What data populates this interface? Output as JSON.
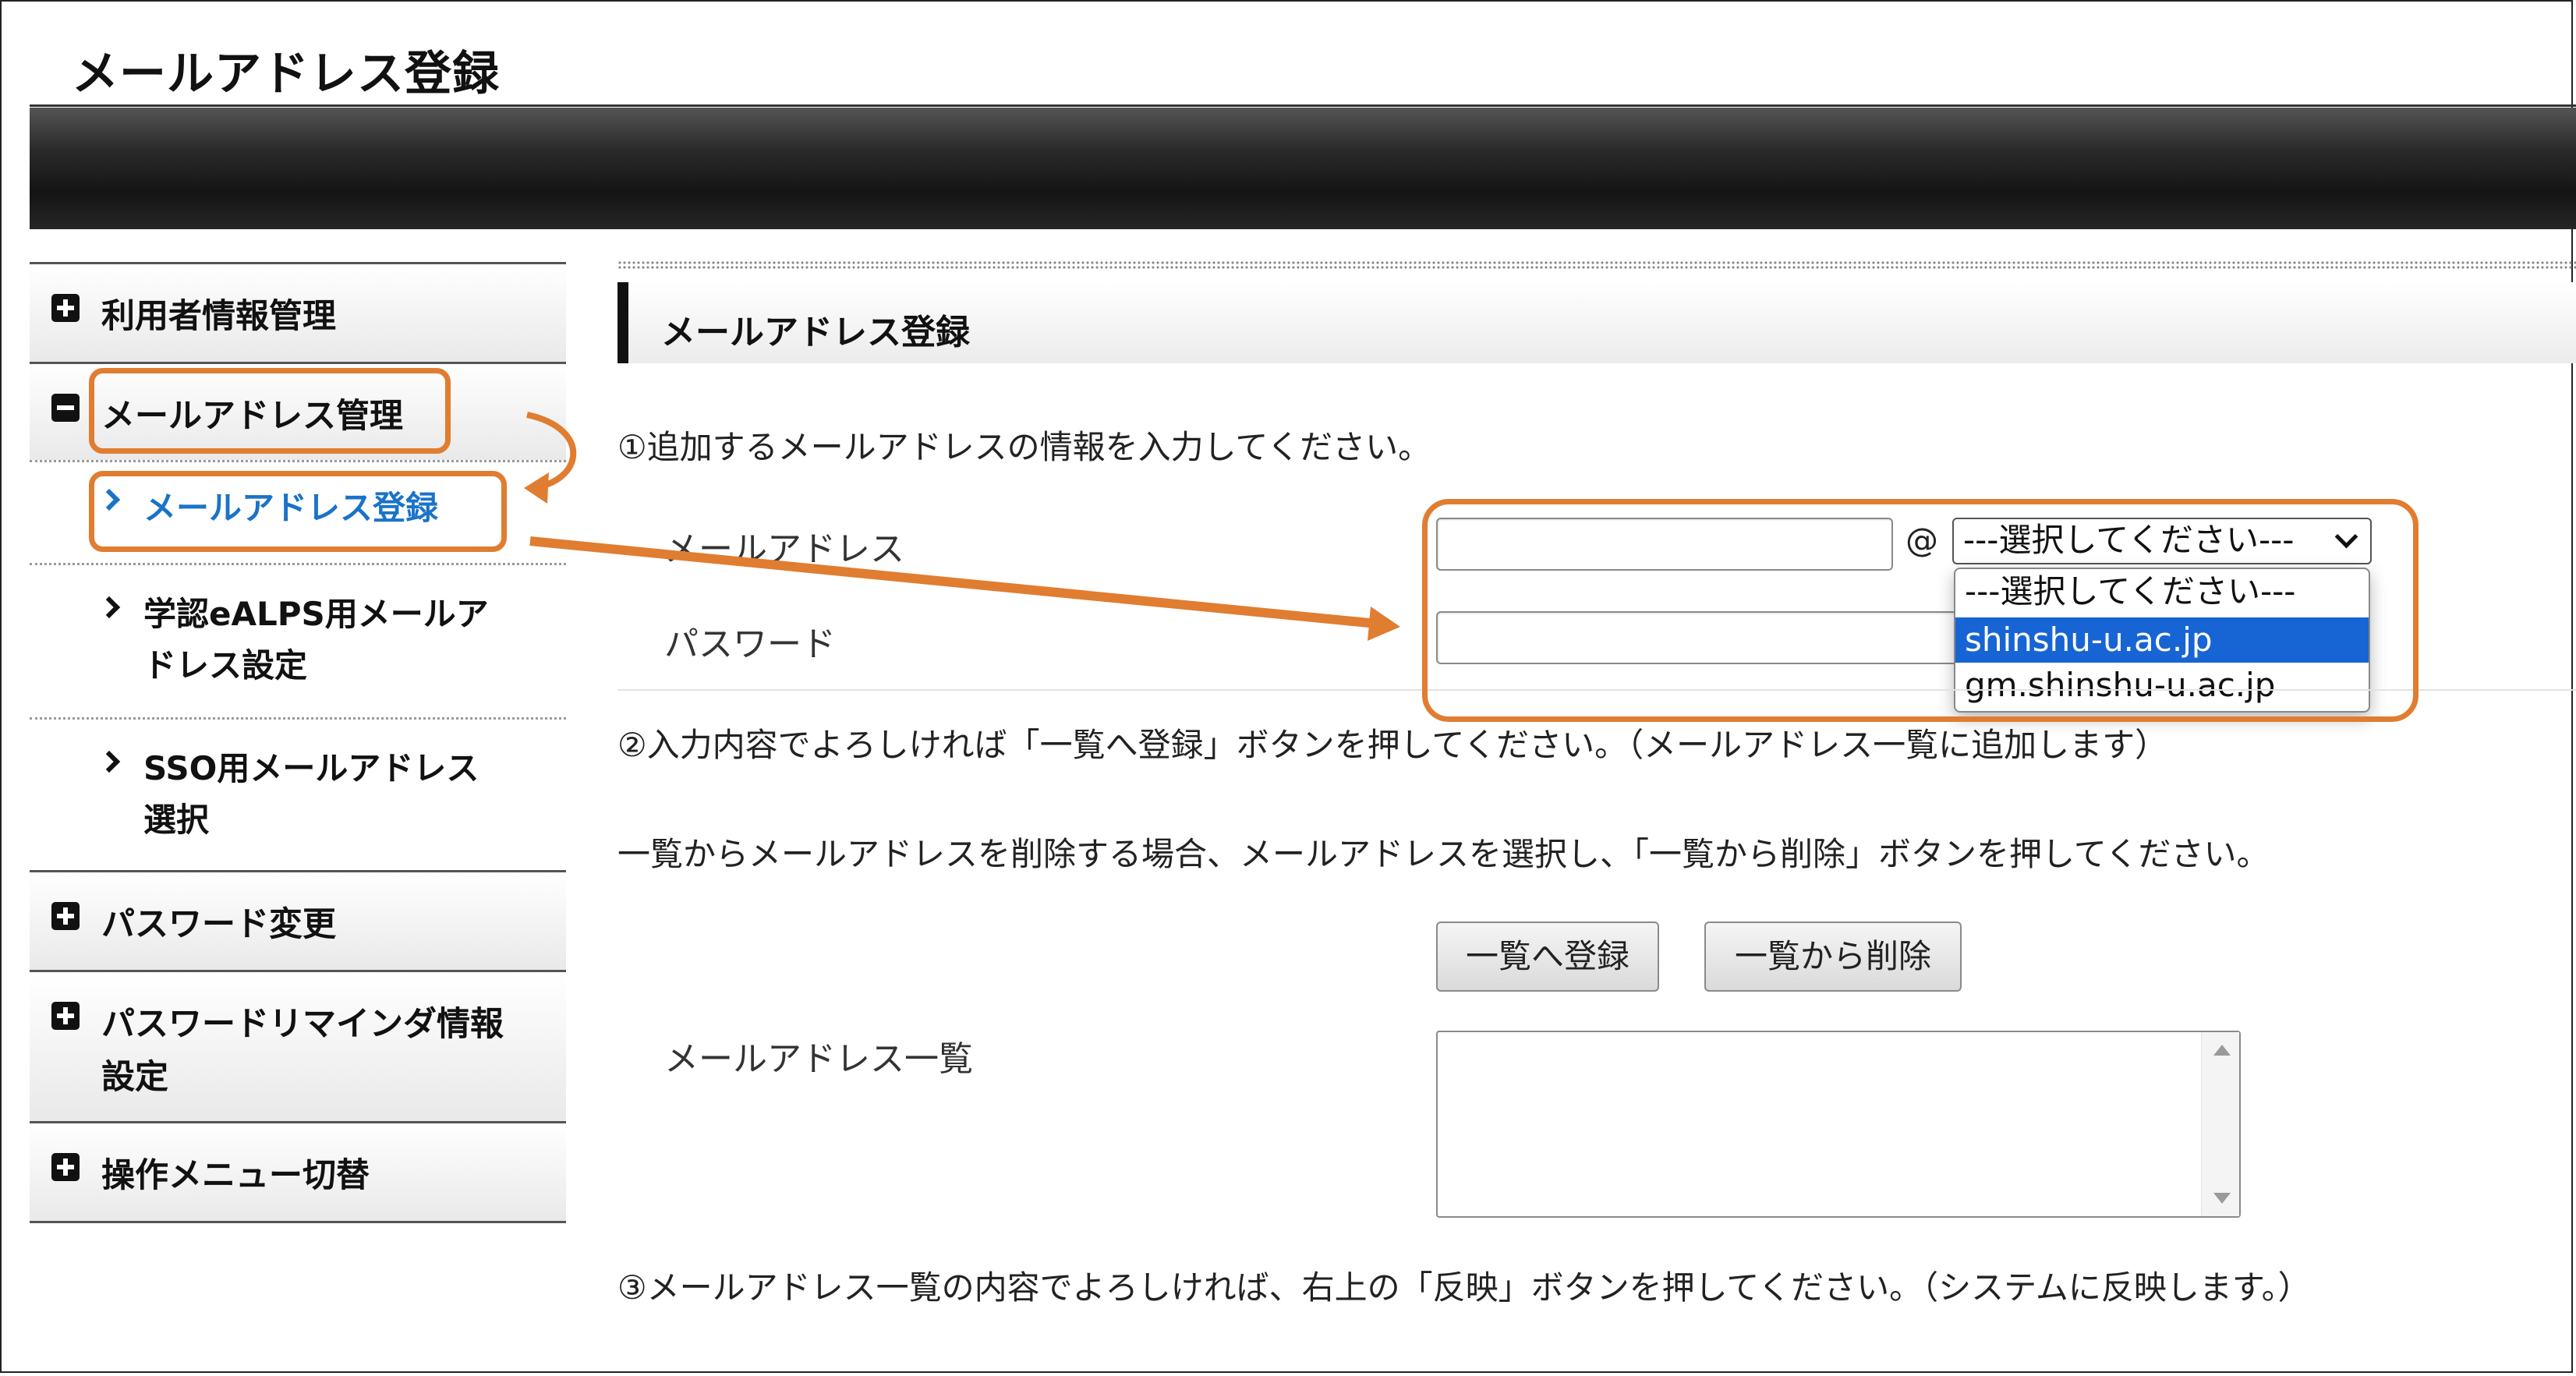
{
  "page": {
    "title": "メールアドレス登録"
  },
  "sidebar": {
    "user_info": "利用者情報管理",
    "mail_manage": "メールアドレス管理",
    "mail_register": "メールアドレス登録",
    "ealps_line1": "学認eALPS用メールア",
    "ealps_line2": "ドレス設定",
    "sso_line1": "SSO用メールアドレス",
    "sso_line2": "選択",
    "password_change": "パスワード変更",
    "reminder_line1": "パスワードリマインダ情報",
    "reminder_line2": "設定",
    "menu_switch": "操作メニュー切替"
  },
  "section": {
    "title": "メールアドレス登録"
  },
  "form": {
    "step1": "①追加するメールアドレスの情報を入力してください。",
    "email_label": "メールアドレス",
    "password_label": "パスワード",
    "email_local_value": "",
    "password_value": "",
    "at": "@",
    "domain_selected": "---選択してください---",
    "domain_options": [
      "---選択してください---",
      "shinshu-u.ac.jp",
      "gm.shinshu-u.ac.jp"
    ],
    "highlighted_option": "shinshu-u.ac.jp",
    "step2": "②入力内容でよろしければ「一覧へ登録」ボタンを押してください。（メールアドレス一覧に追加します）",
    "delete_note": "一覧からメールアドレスを削除する場合、メールアドレスを選択し、「一覧から削除」ボタンを押してください。",
    "register_button": "一覧へ登録",
    "delete_button": "一覧から削除",
    "list_label": "メールアドレス一覧",
    "list_items": [],
    "step3": "③メールアドレス一覧の内容でよろしければ、右上の「反映」ボタンを押してください。（システムに反映します。）"
  },
  "colors": {
    "annotation": "#e07d30",
    "active_link": "#1a73c8",
    "selected_option": "#1764d4"
  }
}
